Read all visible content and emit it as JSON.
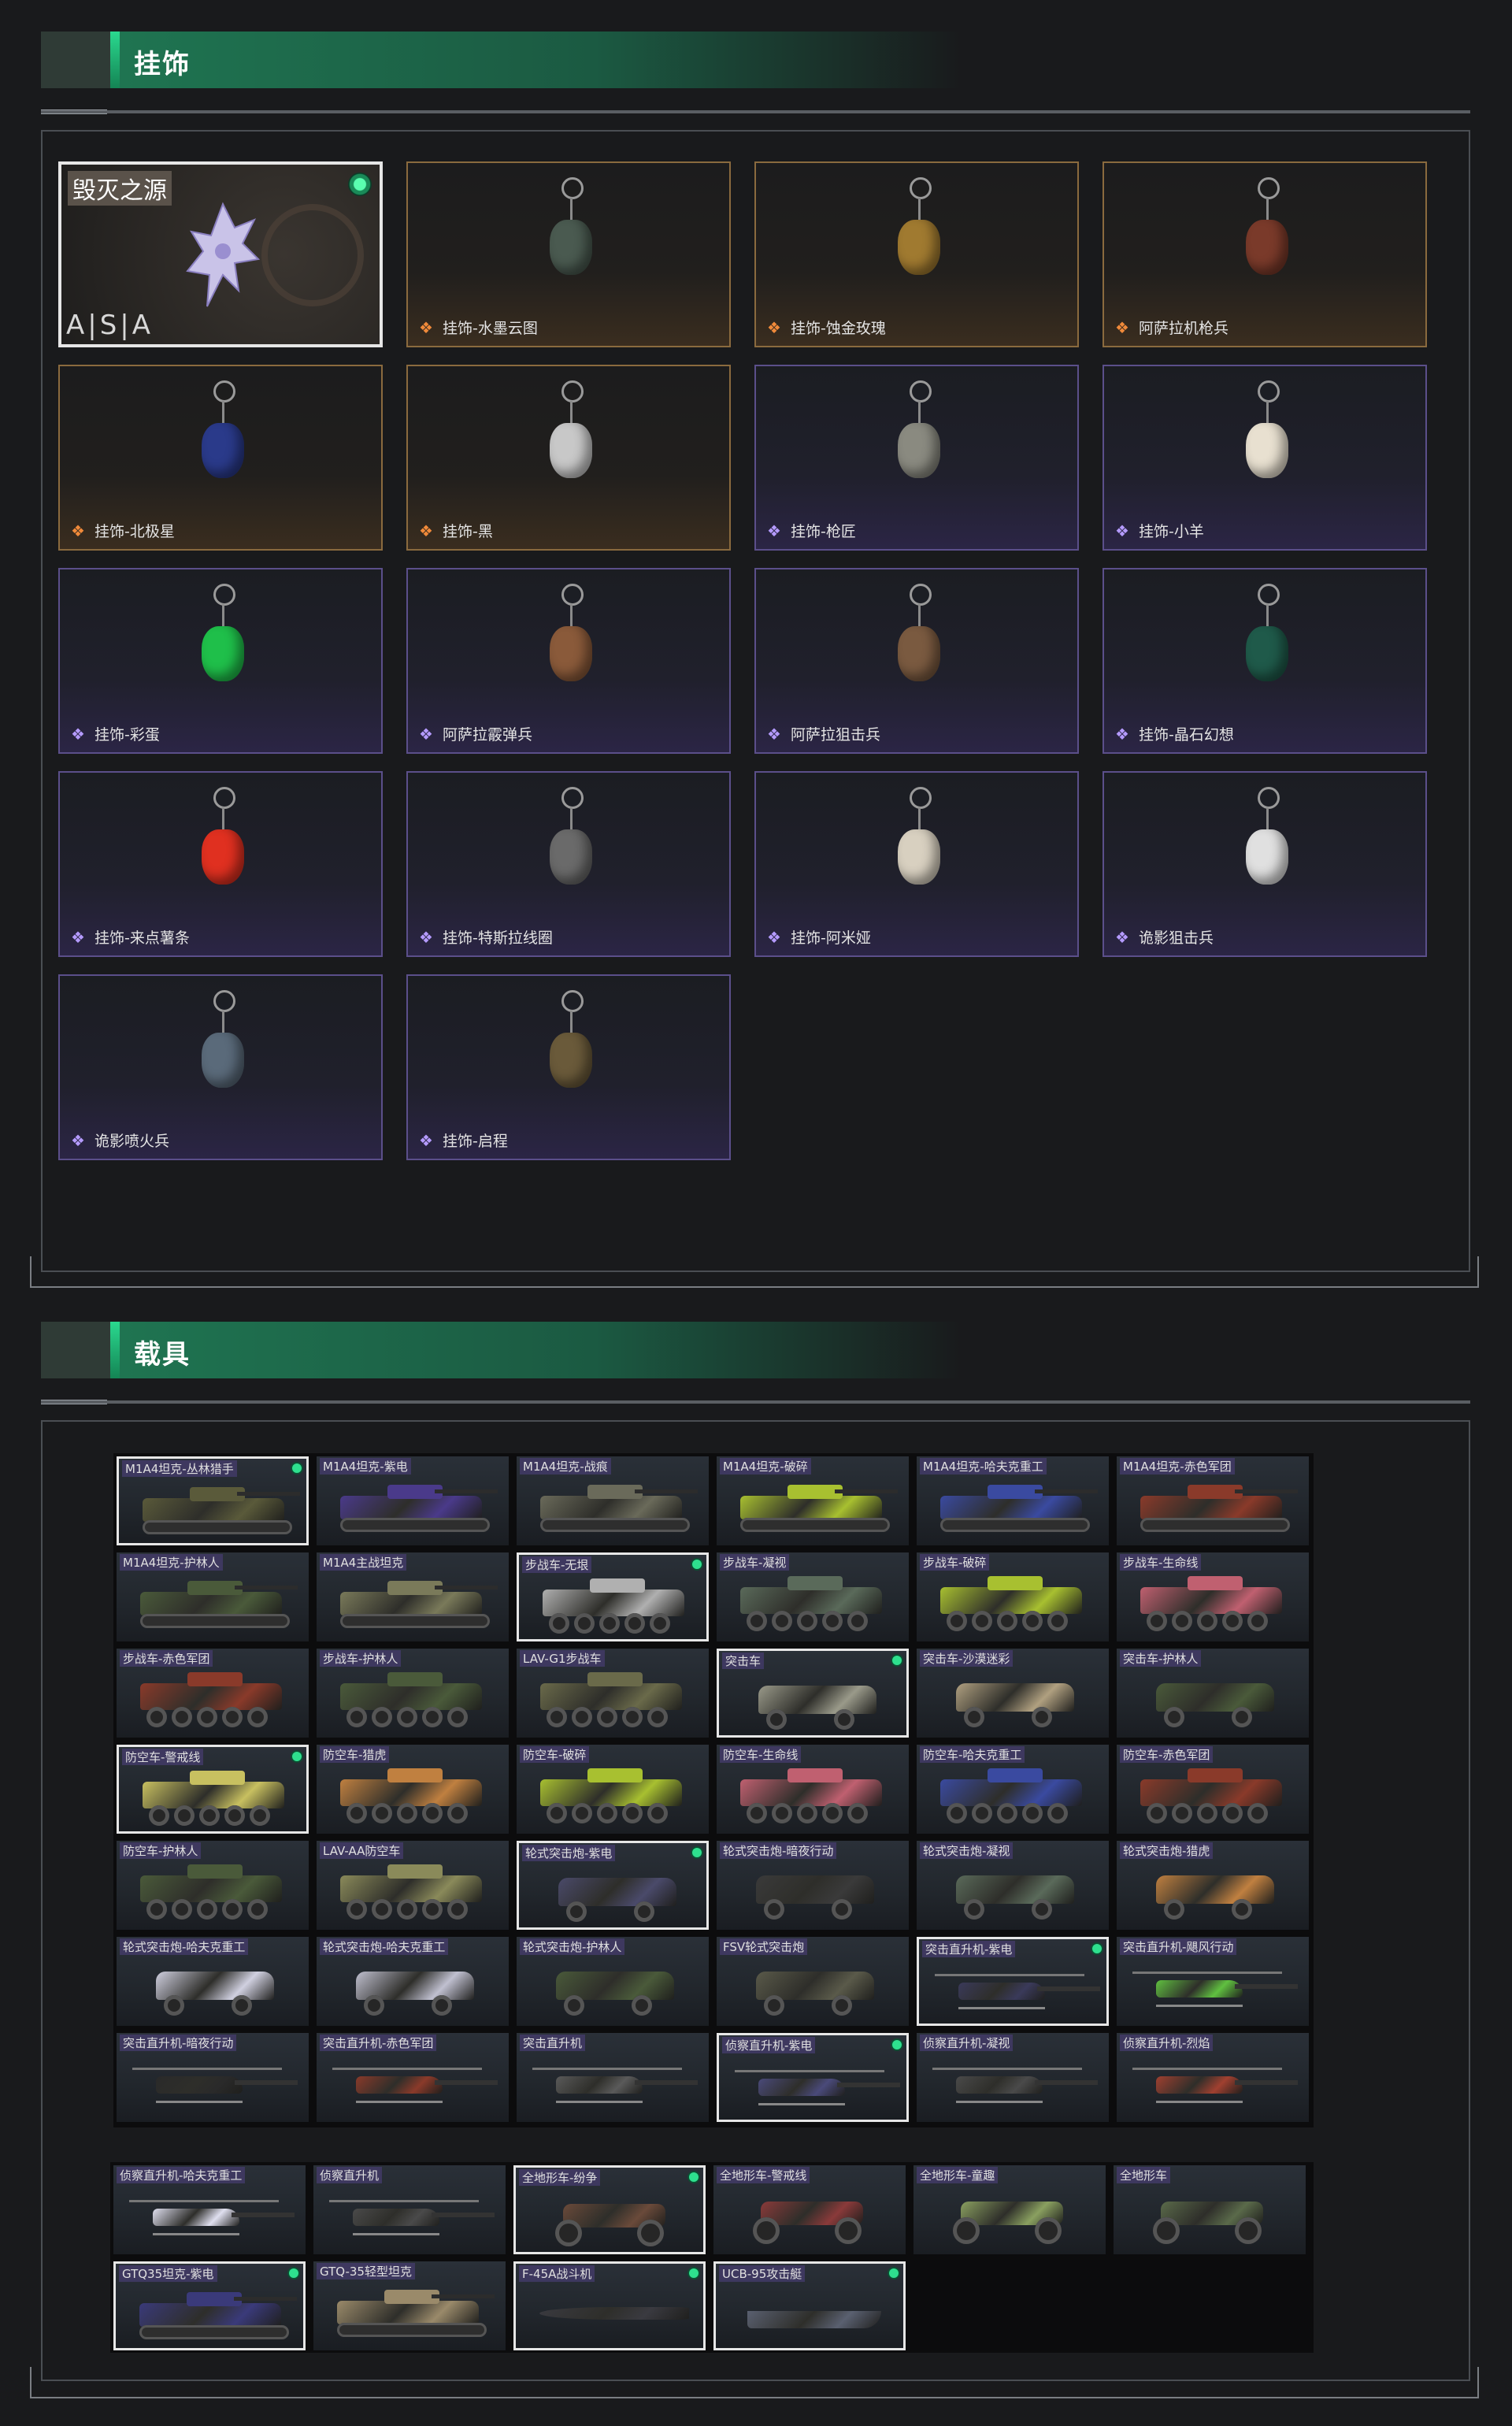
{
  "sections": {
    "charms_title": "挂饰",
    "vehicles_title": "载具"
  },
  "featured_charm": {
    "title": "毁灭之源",
    "brand": "A|S|A"
  },
  "charms": [
    {
      "label": "挂饰-水墨云图",
      "rarity": "gold",
      "color": "#4a5a50"
    },
    {
      "label": "挂饰-蚀金玫瑰",
      "rarity": "gold",
      "color": "#a07a30"
    },
    {
      "label": "阿萨拉机枪兵",
      "rarity": "gold",
      "color": "#7a3a2a"
    },
    {
      "label": "挂饰-北极星",
      "rarity": "gold",
      "color": "#2a3a8a"
    },
    {
      "label": "挂饰-黑",
      "rarity": "gold",
      "color": "#c8c8c8"
    },
    {
      "label": "挂饰-枪匠",
      "rarity": "purple",
      "color": "#8a8a80"
    },
    {
      "label": "挂饰-小羊",
      "rarity": "purple",
      "color": "#e8e0d0"
    },
    {
      "label": "挂饰-彩蛋",
      "rarity": "purple",
      "color": "#1fbf4a"
    },
    {
      "label": "阿萨拉霰弹兵",
      "rarity": "purple",
      "color": "#8a5a3a"
    },
    {
      "label": "阿萨拉狙击兵",
      "rarity": "purple",
      "color": "#7a5a40"
    },
    {
      "label": "挂饰-晶石幻想",
      "rarity": "purple",
      "color": "#1f5a4a"
    },
    {
      "label": "挂饰-来点薯条",
      "rarity": "purple",
      "color": "#e03020"
    },
    {
      "label": "挂饰-特斯拉线圈",
      "rarity": "purple",
      "color": "#6a6a6a"
    },
    {
      "label": "挂饰-阿米娅",
      "rarity": "purple",
      "color": "#d8d0c0"
    },
    {
      "label": "诡影狙击兵",
      "rarity": "purple",
      "color": "#e0e0e0"
    },
    {
      "label": "诡影喷火兵",
      "rarity": "purple",
      "color": "#5a6a7a"
    },
    {
      "label": "挂饰-启程",
      "rarity": "purple",
      "color": "#6a5a3a"
    }
  ],
  "vehicles_main": [
    {
      "label": "M1A4坦克-丛林猎手",
      "type": "tank",
      "color": "#5a5a3a",
      "selected": true,
      "owned": true
    },
    {
      "label": "M1A4坦克-紫电",
      "type": "tank",
      "color": "#4a3a8a"
    },
    {
      "label": "M1A4坦克-战痕",
      "type": "tank",
      "color": "#6a6a5a"
    },
    {
      "label": "M1A4坦克-破碎",
      "type": "tank",
      "color": "#a8c030"
    },
    {
      "label": "M1A4坦克-哈夫克重工",
      "type": "tank",
      "color": "#3a4aa0"
    },
    {
      "label": "M1A4坦克-赤色军团",
      "type": "tank",
      "color": "#8a3a2a"
    },
    {
      "label": "M1A4坦克-护林人",
      "type": "tank",
      "color": "#4a5a3a"
    },
    {
      "label": "M1A4主战坦克",
      "type": "tank",
      "color": "#7a7a5a"
    },
    {
      "label": "步战车-无垠",
      "type": "ifv",
      "color": "#b0b0b0",
      "selected": true,
      "owned": true
    },
    {
      "label": "步战车-凝视",
      "type": "ifv",
      "color": "#5a6a5a"
    },
    {
      "label": "步战车-破碎",
      "type": "ifv",
      "color": "#a8c030"
    },
    {
      "label": "步战车-生命线",
      "type": "ifv",
      "color": "#c06070"
    },
    {
      "label": "步战车-赤色军团",
      "type": "ifv",
      "color": "#8a3a2a"
    },
    {
      "label": "步战车-护林人",
      "type": "ifv",
      "color": "#4a5a3a"
    },
    {
      "label": "LAV-G1步战车",
      "type": "ifv",
      "color": "#6a6a4a"
    },
    {
      "label": "突击车",
      "type": "car",
      "color": "#9a9a8a",
      "selected": true,
      "owned": true
    },
    {
      "label": "突击车-沙漠迷彩",
      "type": "car",
      "color": "#b0a080"
    },
    {
      "label": "突击车-护林人",
      "type": "car",
      "color": "#4a5a3a"
    },
    {
      "label": "防空车-警戒线",
      "type": "aa",
      "color": "#c8c060",
      "selected": true,
      "owned": true
    },
    {
      "label": "防空车-猎虎",
      "type": "aa",
      "color": "#c08040"
    },
    {
      "label": "防空车-破碎",
      "type": "aa",
      "color": "#a8c030"
    },
    {
      "label": "防空车-生命线",
      "type": "aa",
      "color": "#c06070"
    },
    {
      "label": "防空车-哈夫克重工",
      "type": "aa",
      "color": "#3a4aa0"
    },
    {
      "label": "防空车-赤色军团",
      "type": "aa",
      "color": "#8a3a2a"
    },
    {
      "label": "防空车-护林人",
      "type": "aa",
      "color": "#4a5a3a"
    },
    {
      "label": "LAV-AA防空车",
      "type": "aa",
      "color": "#8a8a5a"
    },
    {
      "label": "轮式突击炮-紫电",
      "type": "car",
      "color": "#4a4a6a",
      "selected": true,
      "owned": true
    },
    {
      "label": "轮式突击炮-暗夜行动",
      "type": "car",
      "color": "#3a3a3a"
    },
    {
      "label": "轮式突击炮-凝视",
      "type": "car",
      "color": "#5a6a5a"
    },
    {
      "label": "轮式突击炮-猎虎",
      "type": "car",
      "color": "#c08040"
    },
    {
      "label": "轮式突击炮-哈夫克重工",
      "type": "car",
      "color": "#d0d0e0"
    },
    {
      "label": "轮式突击炮-哈夫克重工",
      "type": "car",
      "color": "#c0c0d0"
    },
    {
      "label": "轮式突击炮-护林人",
      "type": "car",
      "color": "#4a5a3a"
    },
    {
      "label": "FSV轮式突击炮",
      "type": "car",
      "color": "#5a5a4a"
    },
    {
      "label": "突击直升机-紫电",
      "type": "heli",
      "color": "#3a3a5a",
      "selected": true,
      "owned": true
    },
    {
      "label": "突击直升机-飓风行动",
      "type": "heli",
      "color": "#60c040"
    },
    {
      "label": "突击直升机-暗夜行动",
      "type": "heli",
      "color": "#2a2a2a"
    },
    {
      "label": "突击直升机-赤色军团",
      "type": "heli",
      "color": "#8a3a2a"
    },
    {
      "label": "突击直升机",
      "type": "heli",
      "color": "#5a5a5a"
    },
    {
      "label": "侦察直升机-紫电",
      "type": "heli",
      "color": "#4a4a7a",
      "selected": true,
      "owned": true
    },
    {
      "label": "侦察直升机-凝视",
      "type": "heli",
      "color": "#4a4a4a"
    },
    {
      "label": "侦察直升机-烈焰",
      "type": "heli",
      "color": "#a04030"
    }
  ],
  "vehicles_extra": [
    {
      "label": "侦察直升机-哈夫克重工",
      "type": "heli",
      "color": "#e0e0f0"
    },
    {
      "label": "侦察直升机",
      "type": "heli",
      "color": "#4a4a4a"
    },
    {
      "label": "全地形车-纷争",
      "type": "atv",
      "color": "#6a4a3a",
      "selected": true,
      "owned": true
    },
    {
      "label": "全地形车-警戒线",
      "type": "atv",
      "color": "#8a3a3a"
    },
    {
      "label": "全地形车-童趣",
      "type": "atv",
      "color": "#8aa060"
    },
    {
      "label": "全地形车",
      "type": "atv",
      "color": "#5a6a4a"
    },
    {
      "label": "GTQ35坦克-紫电",
      "type": "tank",
      "color": "#3a3a7a",
      "selected": true,
      "owned": true
    },
    {
      "label": "GTQ-35轻型坦克",
      "type": "tank",
      "color": "#9a8a6a"
    },
    {
      "label": "F-45A战斗机",
      "type": "jet",
      "color": "#3a3a40",
      "selected": true,
      "owned": true
    },
    {
      "label": "UCB-95攻击艇",
      "type": "boat",
      "color": "#5a6070",
      "selected": true,
      "owned": true
    }
  ]
}
